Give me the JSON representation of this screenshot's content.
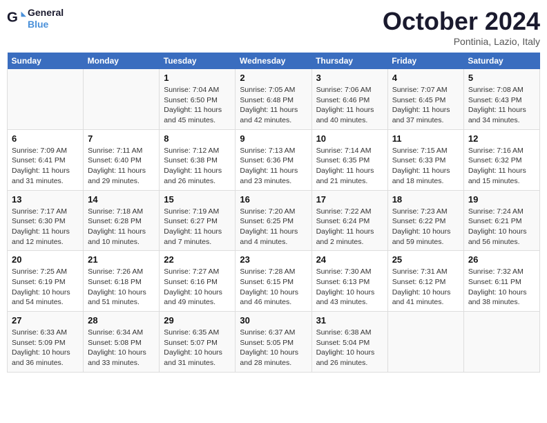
{
  "header": {
    "logo_line1": "General",
    "logo_line2": "Blue",
    "month_title": "October 2024",
    "location": "Pontinia, Lazio, Italy"
  },
  "weekdays": [
    "Sunday",
    "Monday",
    "Tuesday",
    "Wednesday",
    "Thursday",
    "Friday",
    "Saturday"
  ],
  "weeks": [
    [
      {
        "day": "",
        "sunrise": "",
        "sunset": "",
        "daylight": ""
      },
      {
        "day": "",
        "sunrise": "",
        "sunset": "",
        "daylight": ""
      },
      {
        "day": "1",
        "sunrise": "Sunrise: 7:04 AM",
        "sunset": "Sunset: 6:50 PM",
        "daylight": "Daylight: 11 hours and 45 minutes."
      },
      {
        "day": "2",
        "sunrise": "Sunrise: 7:05 AM",
        "sunset": "Sunset: 6:48 PM",
        "daylight": "Daylight: 11 hours and 42 minutes."
      },
      {
        "day": "3",
        "sunrise": "Sunrise: 7:06 AM",
        "sunset": "Sunset: 6:46 PM",
        "daylight": "Daylight: 11 hours and 40 minutes."
      },
      {
        "day": "4",
        "sunrise": "Sunrise: 7:07 AM",
        "sunset": "Sunset: 6:45 PM",
        "daylight": "Daylight: 11 hours and 37 minutes."
      },
      {
        "day": "5",
        "sunrise": "Sunrise: 7:08 AM",
        "sunset": "Sunset: 6:43 PM",
        "daylight": "Daylight: 11 hours and 34 minutes."
      }
    ],
    [
      {
        "day": "6",
        "sunrise": "Sunrise: 7:09 AM",
        "sunset": "Sunset: 6:41 PM",
        "daylight": "Daylight: 11 hours and 31 minutes."
      },
      {
        "day": "7",
        "sunrise": "Sunrise: 7:11 AM",
        "sunset": "Sunset: 6:40 PM",
        "daylight": "Daylight: 11 hours and 29 minutes."
      },
      {
        "day": "8",
        "sunrise": "Sunrise: 7:12 AM",
        "sunset": "Sunset: 6:38 PM",
        "daylight": "Daylight: 11 hours and 26 minutes."
      },
      {
        "day": "9",
        "sunrise": "Sunrise: 7:13 AM",
        "sunset": "Sunset: 6:36 PM",
        "daylight": "Daylight: 11 hours and 23 minutes."
      },
      {
        "day": "10",
        "sunrise": "Sunrise: 7:14 AM",
        "sunset": "Sunset: 6:35 PM",
        "daylight": "Daylight: 11 hours and 21 minutes."
      },
      {
        "day": "11",
        "sunrise": "Sunrise: 7:15 AM",
        "sunset": "Sunset: 6:33 PM",
        "daylight": "Daylight: 11 hours and 18 minutes."
      },
      {
        "day": "12",
        "sunrise": "Sunrise: 7:16 AM",
        "sunset": "Sunset: 6:32 PM",
        "daylight": "Daylight: 11 hours and 15 minutes."
      }
    ],
    [
      {
        "day": "13",
        "sunrise": "Sunrise: 7:17 AM",
        "sunset": "Sunset: 6:30 PM",
        "daylight": "Daylight: 11 hours and 12 minutes."
      },
      {
        "day": "14",
        "sunrise": "Sunrise: 7:18 AM",
        "sunset": "Sunset: 6:28 PM",
        "daylight": "Daylight: 11 hours and 10 minutes."
      },
      {
        "day": "15",
        "sunrise": "Sunrise: 7:19 AM",
        "sunset": "Sunset: 6:27 PM",
        "daylight": "Daylight: 11 hours and 7 minutes."
      },
      {
        "day": "16",
        "sunrise": "Sunrise: 7:20 AM",
        "sunset": "Sunset: 6:25 PM",
        "daylight": "Daylight: 11 hours and 4 minutes."
      },
      {
        "day": "17",
        "sunrise": "Sunrise: 7:22 AM",
        "sunset": "Sunset: 6:24 PM",
        "daylight": "Daylight: 11 hours and 2 minutes."
      },
      {
        "day": "18",
        "sunrise": "Sunrise: 7:23 AM",
        "sunset": "Sunset: 6:22 PM",
        "daylight": "Daylight: 10 hours and 59 minutes."
      },
      {
        "day": "19",
        "sunrise": "Sunrise: 7:24 AM",
        "sunset": "Sunset: 6:21 PM",
        "daylight": "Daylight: 10 hours and 56 minutes."
      }
    ],
    [
      {
        "day": "20",
        "sunrise": "Sunrise: 7:25 AM",
        "sunset": "Sunset: 6:19 PM",
        "daylight": "Daylight: 10 hours and 54 minutes."
      },
      {
        "day": "21",
        "sunrise": "Sunrise: 7:26 AM",
        "sunset": "Sunset: 6:18 PM",
        "daylight": "Daylight: 10 hours and 51 minutes."
      },
      {
        "day": "22",
        "sunrise": "Sunrise: 7:27 AM",
        "sunset": "Sunset: 6:16 PM",
        "daylight": "Daylight: 10 hours and 49 minutes."
      },
      {
        "day": "23",
        "sunrise": "Sunrise: 7:28 AM",
        "sunset": "Sunset: 6:15 PM",
        "daylight": "Daylight: 10 hours and 46 minutes."
      },
      {
        "day": "24",
        "sunrise": "Sunrise: 7:30 AM",
        "sunset": "Sunset: 6:13 PM",
        "daylight": "Daylight: 10 hours and 43 minutes."
      },
      {
        "day": "25",
        "sunrise": "Sunrise: 7:31 AM",
        "sunset": "Sunset: 6:12 PM",
        "daylight": "Daylight: 10 hours and 41 minutes."
      },
      {
        "day": "26",
        "sunrise": "Sunrise: 7:32 AM",
        "sunset": "Sunset: 6:11 PM",
        "daylight": "Daylight: 10 hours and 38 minutes."
      }
    ],
    [
      {
        "day": "27",
        "sunrise": "Sunrise: 6:33 AM",
        "sunset": "Sunset: 5:09 PM",
        "daylight": "Daylight: 10 hours and 36 minutes."
      },
      {
        "day": "28",
        "sunrise": "Sunrise: 6:34 AM",
        "sunset": "Sunset: 5:08 PM",
        "daylight": "Daylight: 10 hours and 33 minutes."
      },
      {
        "day": "29",
        "sunrise": "Sunrise: 6:35 AM",
        "sunset": "Sunset: 5:07 PM",
        "daylight": "Daylight: 10 hours and 31 minutes."
      },
      {
        "day": "30",
        "sunrise": "Sunrise: 6:37 AM",
        "sunset": "Sunset: 5:05 PM",
        "daylight": "Daylight: 10 hours and 28 minutes."
      },
      {
        "day": "31",
        "sunrise": "Sunrise: 6:38 AM",
        "sunset": "Sunset: 5:04 PM",
        "daylight": "Daylight: 10 hours and 26 minutes."
      },
      {
        "day": "",
        "sunrise": "",
        "sunset": "",
        "daylight": ""
      },
      {
        "day": "",
        "sunrise": "",
        "sunset": "",
        "daylight": ""
      }
    ]
  ]
}
